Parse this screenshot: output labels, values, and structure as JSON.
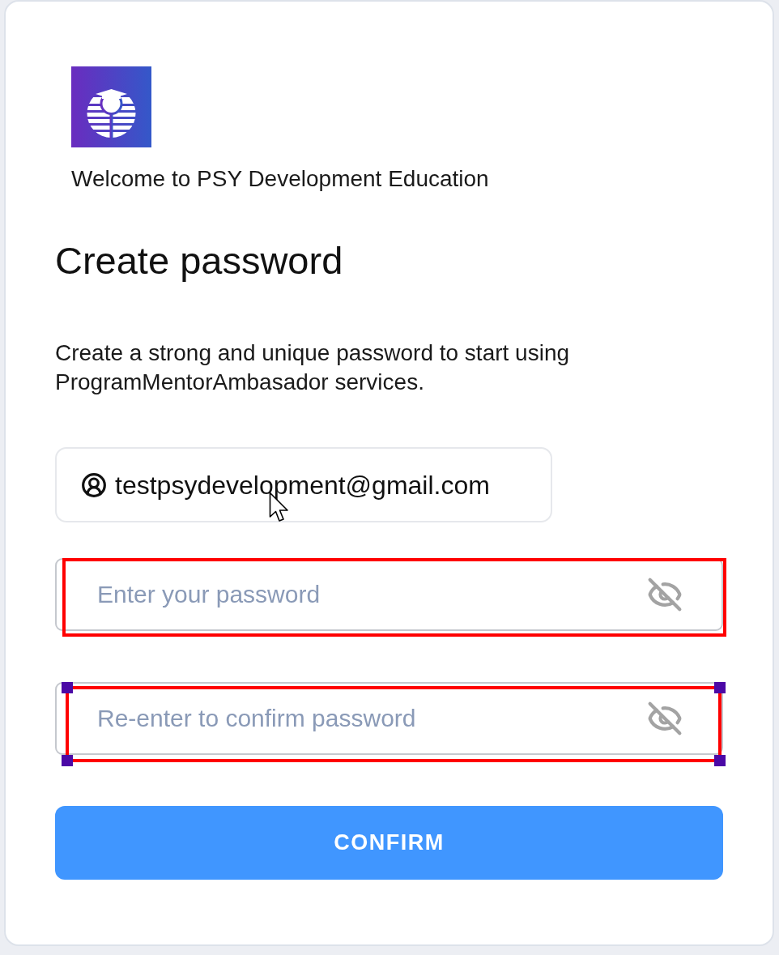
{
  "welcome": "Welcome to PSY Development Education",
  "title": "Create password",
  "description": "Create a strong and unique password to start using ProgramMentorAmbasador services.",
  "account": {
    "email": "testpsydevelopment@gmail.com"
  },
  "password_fields": [
    {
      "placeholder": "Enter your password",
      "highlighted": true,
      "selected": false
    },
    {
      "placeholder": "Re-enter to confirm password",
      "highlighted": true,
      "selected": true
    }
  ],
  "confirm_button": {
    "label": "CONFIRM"
  }
}
